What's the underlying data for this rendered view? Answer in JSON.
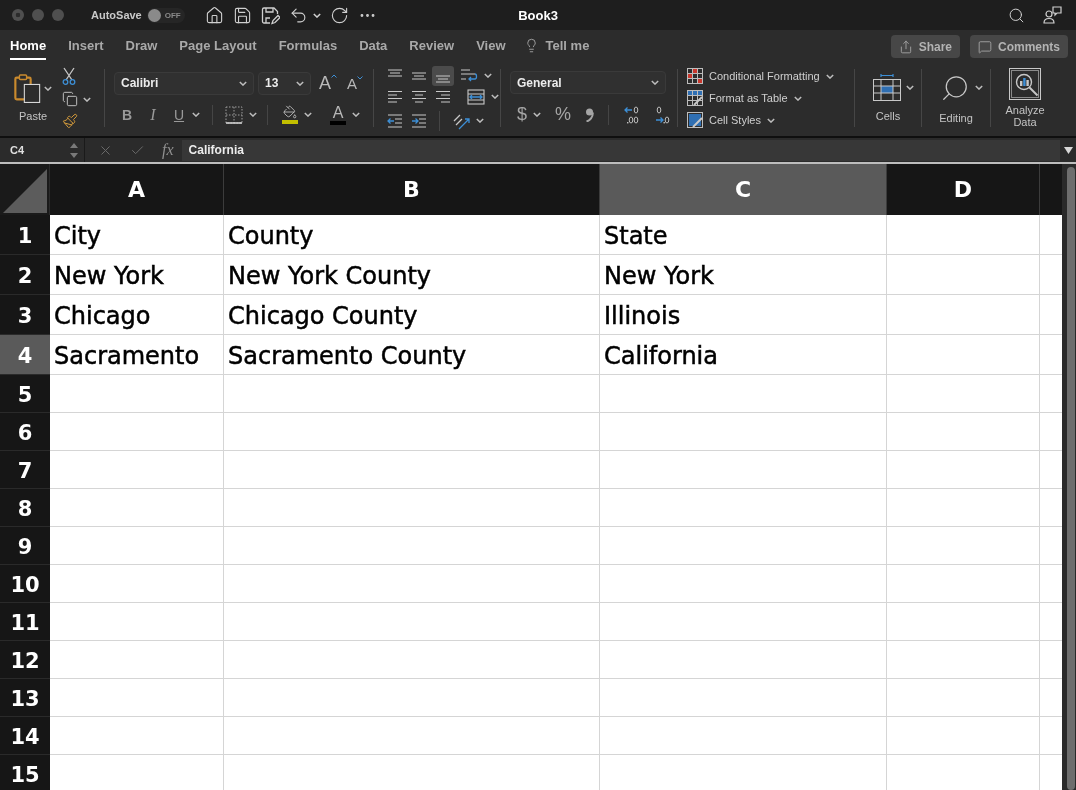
{
  "window": {
    "title": "Book3",
    "autosave": {
      "label": "AutoSave",
      "on": false,
      "state": "OFF"
    }
  },
  "menu_tabs": [
    {
      "label": "Home",
      "selected": true
    },
    {
      "label": "Insert",
      "selected": false
    },
    {
      "label": "Draw",
      "selected": false
    },
    {
      "label": "Page Layout",
      "selected": false
    },
    {
      "label": "Formulas",
      "selected": false
    },
    {
      "label": "Data",
      "selected": false
    },
    {
      "label": "Review",
      "selected": false
    },
    {
      "label": "View",
      "selected": false
    }
  ],
  "tell_me": "Tell me",
  "header_buttons": [
    {
      "kind": "share",
      "label": "Share"
    },
    {
      "kind": "comments",
      "label": "Comments"
    }
  ],
  "ribbon": {
    "clipboard": {
      "paste_label": "Paste"
    },
    "font": {
      "name": "Calibri",
      "size": "13",
      "grow_label": "A",
      "shrink_label": "A",
      "styles": [
        {
          "kind": "bold",
          "label": "B"
        },
        {
          "kind": "italic",
          "label": "I"
        },
        {
          "kind": "underline",
          "label": "U"
        }
      ],
      "color_buttons": [
        {
          "kind": "fill",
          "color": "#c2bf00"
        },
        {
          "kind": "font",
          "label": "A",
          "color": "#000000"
        }
      ]
    },
    "alignment": {
      "vertical": [
        {
          "kind": "top",
          "selected": false
        },
        {
          "kind": "middle",
          "selected": false
        },
        {
          "kind": "bottom",
          "selected": true
        }
      ]
    },
    "number": {
      "format": "General",
      "currency": "$",
      "percent": "%"
    },
    "styles": [
      {
        "kind": "conditional",
        "label": "Conditional Formatting"
      },
      {
        "kind": "table",
        "label": "Format as Table"
      },
      {
        "kind": "cell",
        "label": "Cell Styles"
      }
    ],
    "groups": [
      {
        "kind": "cells",
        "label": "Cells"
      },
      {
        "kind": "editing",
        "label": "Editing"
      },
      {
        "kind": "analyze",
        "label": "Analyze Data"
      }
    ]
  },
  "formula_bar": {
    "cell_ref": "C4",
    "function_label": "fx",
    "value": "California"
  },
  "sheet": {
    "columns": [
      {
        "label": "A",
        "selected": false
      },
      {
        "label": "B",
        "selected": false
      },
      {
        "label": "C",
        "selected": true
      },
      {
        "label": "D",
        "selected": false
      }
    ],
    "rows": [
      {
        "label": "1",
        "selected": false,
        "cells": [
          "City",
          "County",
          "State"
        ]
      },
      {
        "label": "2",
        "selected": false,
        "cells": [
          "New York",
          "New York County",
          "New York"
        ]
      },
      {
        "label": "3",
        "selected": false,
        "cells": [
          "Chicago",
          "Chicago County",
          "Illinois"
        ]
      },
      {
        "label": "4",
        "selected": true,
        "cells": [
          "Sacramento",
          "Sacramento County",
          "California"
        ]
      },
      {
        "label": "5",
        "selected": false
      },
      {
        "label": "6",
        "selected": false
      },
      {
        "label": "7",
        "selected": false
      },
      {
        "label": "8",
        "selected": false
      },
      {
        "label": "9",
        "selected": false
      },
      {
        "label": "10",
        "selected": false
      },
      {
        "label": "11",
        "selected": false
      },
      {
        "label": "12",
        "selected": false
      },
      {
        "label": "13",
        "selected": false
      },
      {
        "label": "14",
        "selected": false
      },
      {
        "label": "15",
        "selected": false
      }
    ]
  }
}
